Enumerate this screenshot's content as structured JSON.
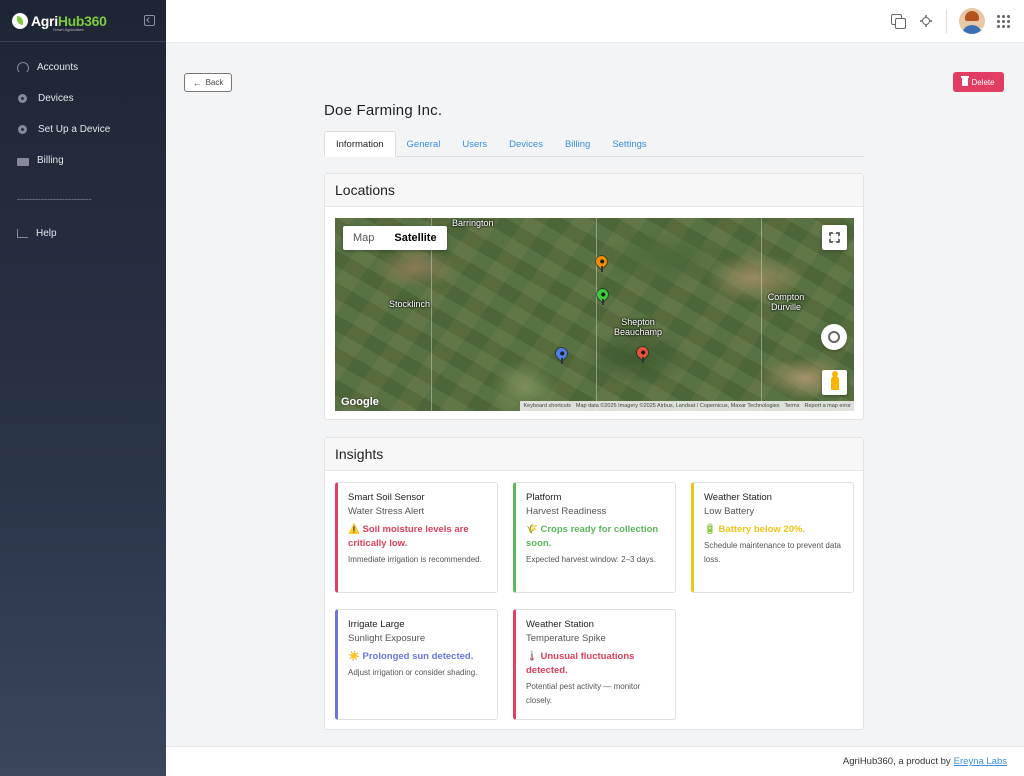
{
  "app": {
    "logo_part1": "Agri",
    "logo_part2": "Hub360",
    "logo_tagline": "Smart Agriculture"
  },
  "sidebar": {
    "items": [
      {
        "label": "Accounts",
        "icon": "dashboard-icon"
      },
      {
        "label": "Devices",
        "icon": "gear-icon"
      },
      {
        "label": "Set Up a Device",
        "icon": "gear-icon"
      },
      {
        "label": "Billing",
        "icon": "credit-card-icon"
      }
    ],
    "divider": "-------------------------",
    "help": {
      "label": "Help",
      "icon": "chart-icon"
    }
  },
  "toolbar": {
    "back_label": "Back",
    "delete_label": "Delete"
  },
  "page": {
    "title": "Doe Farming Inc."
  },
  "tabs": [
    {
      "label": "Information",
      "active": true
    },
    {
      "label": "General"
    },
    {
      "label": "Users"
    },
    {
      "label": "Devices"
    },
    {
      "label": "Billing"
    },
    {
      "label": "Settings"
    }
  ],
  "locations": {
    "heading": "Locations",
    "map_type_map": "Map",
    "map_type_satellite": "Satellite",
    "places": [
      "Barrington",
      "Stocklinch",
      "Shepton Beauchamp",
      "Compton Durville"
    ],
    "google": "Google",
    "attribution": [
      "Keyboard shortcuts",
      "Map data ©2025 Imagery ©2025 Airbus, Landsat / Copernicus, Maxar Technologies",
      "Terms",
      "Report a map error"
    ],
    "markers": [
      {
        "color": "#f28c00"
      },
      {
        "color": "#3ec93a"
      },
      {
        "color": "#4f7ee6"
      },
      {
        "color": "#e8533a"
      }
    ]
  },
  "insights": {
    "heading": "Insights",
    "items": [
      {
        "title": "Smart Soil Sensor",
        "subtitle": "Water Stress Alert",
        "icon": "⚠️",
        "message": "Soil moisture levels are critically low.",
        "note": "Immediate irrigation is recommended.",
        "color": "#e0405e"
      },
      {
        "title": "Platform",
        "subtitle": "Harvest Readiness",
        "icon": "🌾",
        "message": "Crops ready for collection soon.",
        "note": "Expected harvest window: 2–3 days.",
        "color": "#5cb85c"
      },
      {
        "title": "Weather Station",
        "subtitle": "Low Battery",
        "icon": "🔋",
        "message": "Battery below 20%.",
        "note": "Schedule maintenance to prevent data loss.",
        "color": "#f0c419"
      },
      {
        "title": "Irrigate Large",
        "subtitle": "Sunlight Exposure",
        "icon": "☀️",
        "message": "Prolonged sun detected.",
        "note": "Adjust irrigation or consider shading.",
        "color": "#6b74e0"
      },
      {
        "title": "Weather Station",
        "subtitle": "Temperature Spike",
        "icon": "🌡️",
        "message": "Unusual fluctuations detected.",
        "note": "Potential pest activity — monitor closely.",
        "color": "#e0405e"
      }
    ]
  },
  "footer": {
    "text": "AgriHub360, a product by",
    "link": "Ereyna Labs"
  }
}
